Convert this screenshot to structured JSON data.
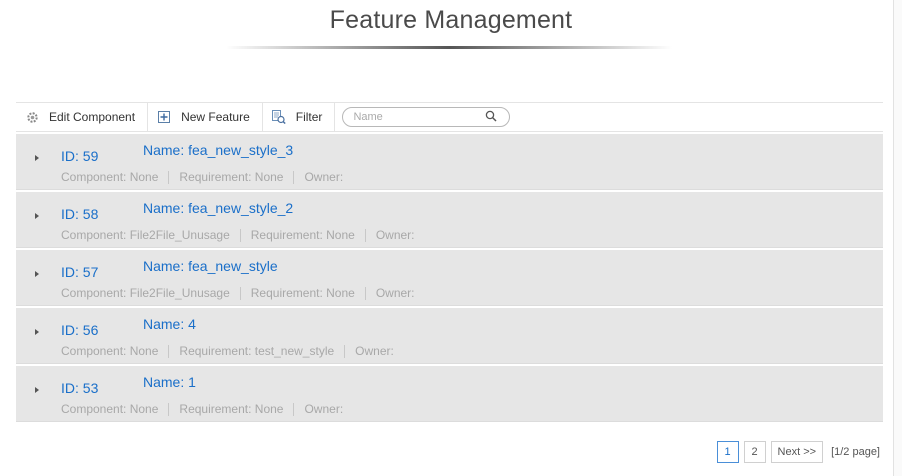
{
  "page": {
    "title": "Feature Management"
  },
  "toolbar": {
    "edit_component_label": "Edit Component",
    "new_feature_label": "New Feature",
    "filter_label": "Filter",
    "search_placeholder": "Name"
  },
  "features": [
    {
      "id": "ID: 59",
      "name": "Name: fea_new_style_3",
      "component": "Component: None",
      "requirement": "Requirement: None",
      "owner": "Owner:"
    },
    {
      "id": "ID: 58",
      "name": "Name: fea_new_style_2",
      "component": "Component: File2File_Unusage",
      "requirement": "Requirement: None",
      "owner": "Owner:"
    },
    {
      "id": "ID: 57",
      "name": "Name: fea_new_style",
      "component": "Component: File2File_Unusage",
      "requirement": "Requirement: None",
      "owner": "Owner:"
    },
    {
      "id": "ID: 56",
      "name": "Name: 4",
      "component": "Component: None",
      "requirement": "Requirement: test_new_style",
      "owner": "Owner:"
    },
    {
      "id": "ID: 53",
      "name": "Name: 1",
      "component": "Component: None",
      "requirement": "Requirement: None",
      "owner": "Owner:"
    }
  ],
  "pagination": {
    "pages": [
      "1",
      "2"
    ],
    "active_page": "1",
    "next_label": "Next >>",
    "page_info": "[1/2 page]"
  },
  "colors": {
    "link": "#1a6fc9",
    "row_background": "#e6e6e6",
    "meta_text": "#a8a8a8"
  }
}
